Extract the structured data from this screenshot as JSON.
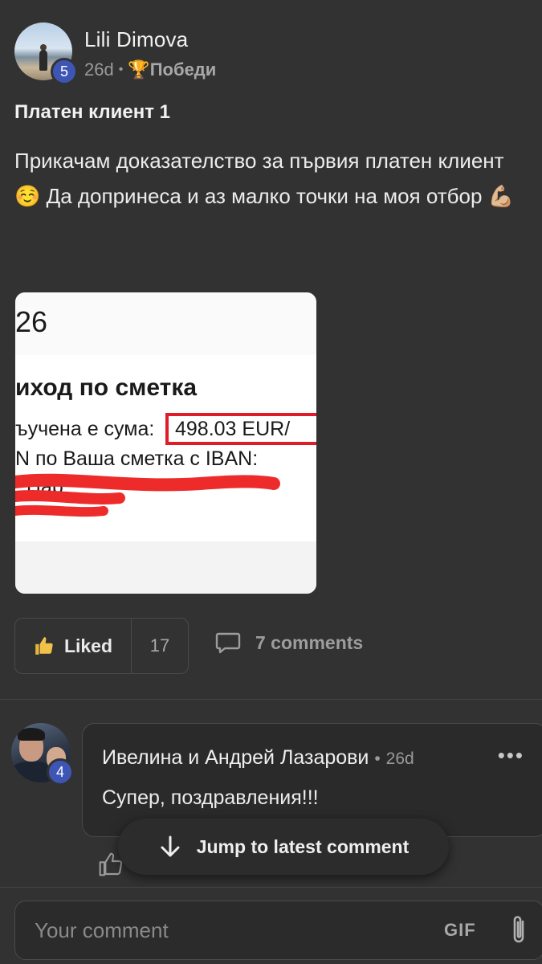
{
  "post": {
    "author": "Lili Dimova",
    "author_level": "5",
    "time": "26d",
    "separator": "•",
    "category_icon": "trophy-icon",
    "category": "Победи",
    "title": "Платен клиент 1",
    "body": "Прикачам доказателство за първия платен клиент ☺️ Да допринеса и аз малко точки на моя отбор 💪🏼",
    "attachment": {
      "year": "26",
      "heading": "иход по сметка",
      "line1": "ъучена е сума:",
      "amount": "498.03 EUR/",
      "line2": "N по Ваша сметка с IBAN:",
      "line3": "                        . Нар"
    },
    "like_label": "Liked",
    "like_count": "17",
    "comments_label": "7 comments"
  },
  "comment": {
    "author": "Ивелина и Андрей Лазарови",
    "author_level": "4",
    "separator": "•",
    "time": "26d",
    "more": "•••",
    "text": "Супер, поздравления!!!"
  },
  "jump_label": "Jump to latest comment",
  "input": {
    "placeholder": "Your comment",
    "gif_label": "GIF"
  },
  "colors": {
    "background": "#323232",
    "level_badge": "#3d56b5",
    "highlight_box": "#e01b2a"
  }
}
